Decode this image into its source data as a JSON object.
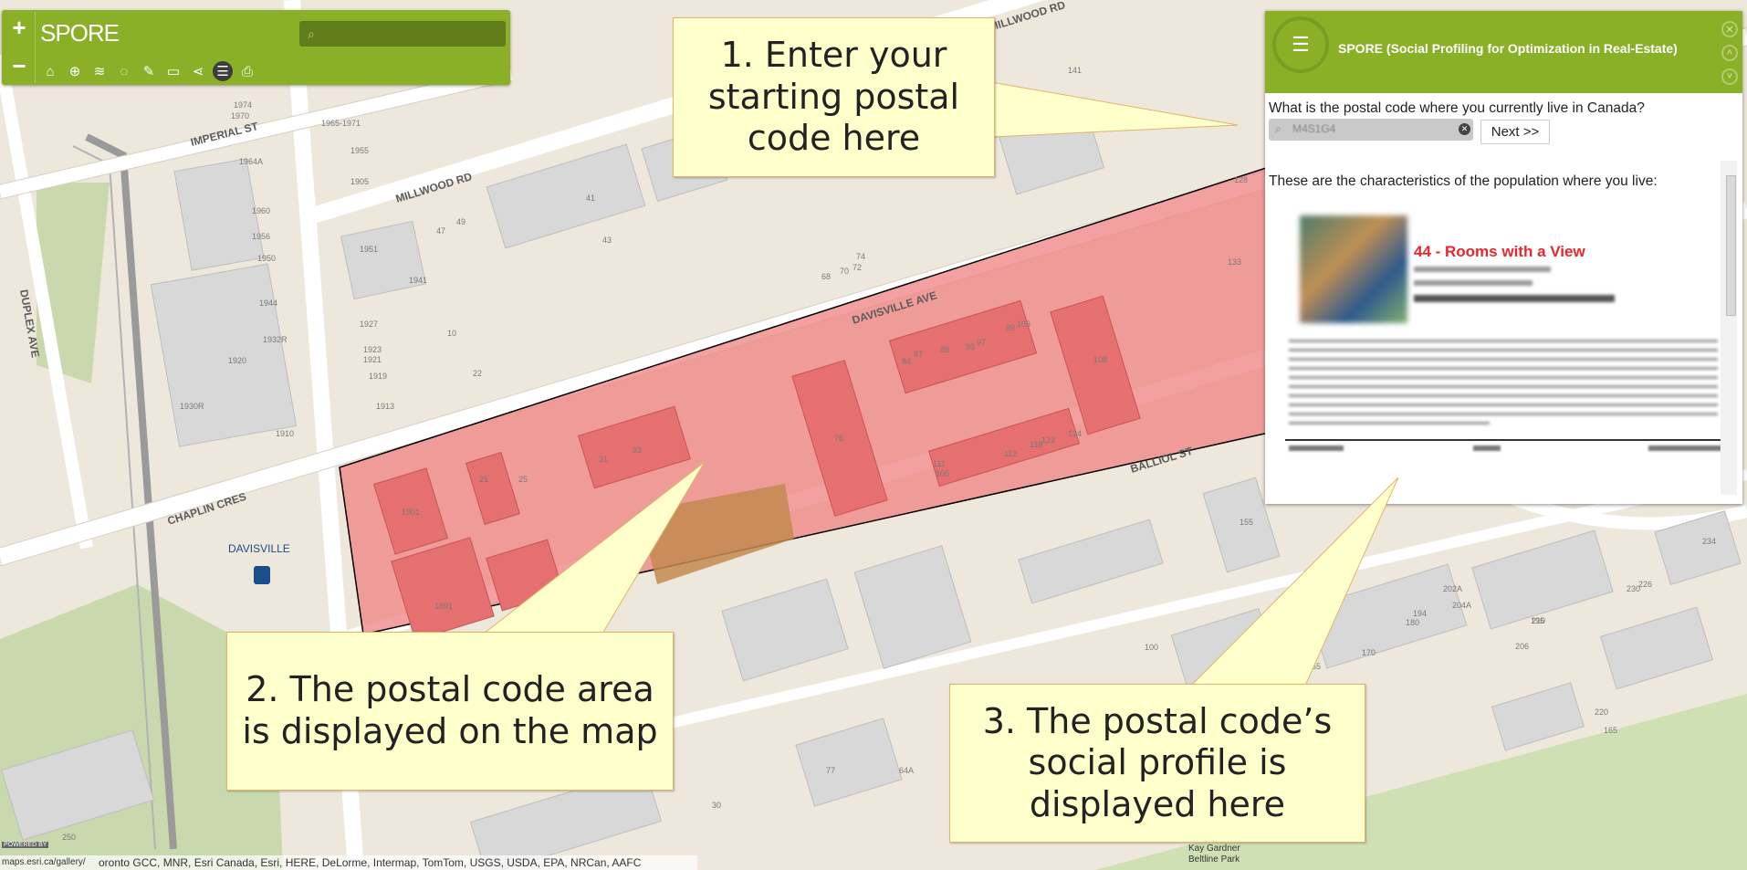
{
  "map": {
    "streets": [
      "IMPERIAL ST",
      "MILLWOOD RD",
      "MILLWOOD RD",
      "DAVISVILLE AVE",
      "BALLIOL ST",
      "CHAPLIN CRES",
      "DUPLEX AVE"
    ],
    "station_label": "DAVISVILLE",
    "park_label_1": "Kay Gardner",
    "park_label_2": "Beltline Park",
    "numbers": [
      "1974",
      "1970",
      "1965-1971",
      "1955",
      "1951",
      "1941",
      "1927",
      "1923",
      "1921",
      "1919",
      "1913",
      "1905",
      "1901",
      "1891",
      "1944",
      "1932R",
      "1920",
      "1910",
      "1930R",
      "1964A",
      "1960",
      "1956",
      "1950",
      "10",
      "22",
      "21",
      "25",
      "31",
      "33",
      "43",
      "41",
      "47",
      "49",
      "68",
      "70",
      "72",
      "74",
      "76",
      "77",
      "84",
      "87",
      "89",
      "93",
      "97",
      "99",
      "103",
      "105",
      "108",
      "111",
      "112",
      "118",
      "122",
      "124",
      "128",
      "133",
      "141",
      "155",
      "165",
      "195",
      "206",
      "210",
      "220",
      "226",
      "230",
      "234",
      "250",
      "30",
      "64A",
      "100",
      "140",
      "155",
      "170",
      "180",
      "194",
      "202A",
      "204A",
      "206A"
    ]
  },
  "toolbar": {
    "zoom_in": "+",
    "zoom_out": "−",
    "title": "SPORE",
    "search_icon": "search-icon",
    "tools": [
      "home-icon",
      "locate-icon",
      "layers-icon",
      "draw-icon",
      "pencil-icon",
      "comment-icon",
      "share-icon",
      "list-icon",
      "print-icon"
    ]
  },
  "panel": {
    "title": "SPORE (Social Profiling for Optimization in Real-Estate)",
    "question": "What is the postal code where you currently live in Canada?",
    "postal_value": "M4S1G4",
    "next_label": "Next >>",
    "characteristics_text": "These are the characteristics of the population where you live:",
    "profile_title": "44 - Rooms with a View"
  },
  "callouts": {
    "c1": "1. Enter your starting postal code here",
    "c2": "2. The postal code area is displayed on the map",
    "c3": "3. The postal code’s social profile is displayed here"
  },
  "attribution": {
    "url": "maps.esri.ca/gallery/",
    "text": "oronto GCC, MNR, Esri Canada, Esri, HERE, DeLorme, Intermap, TomTom, USGS, USDA, EPA, NRCan, AAFC",
    "powered": "POWERED BY"
  },
  "colors": {
    "accent": "#8ab027",
    "highlight": "#f08585",
    "callout": "#ffffcc",
    "profile_title": "#e8262b"
  }
}
